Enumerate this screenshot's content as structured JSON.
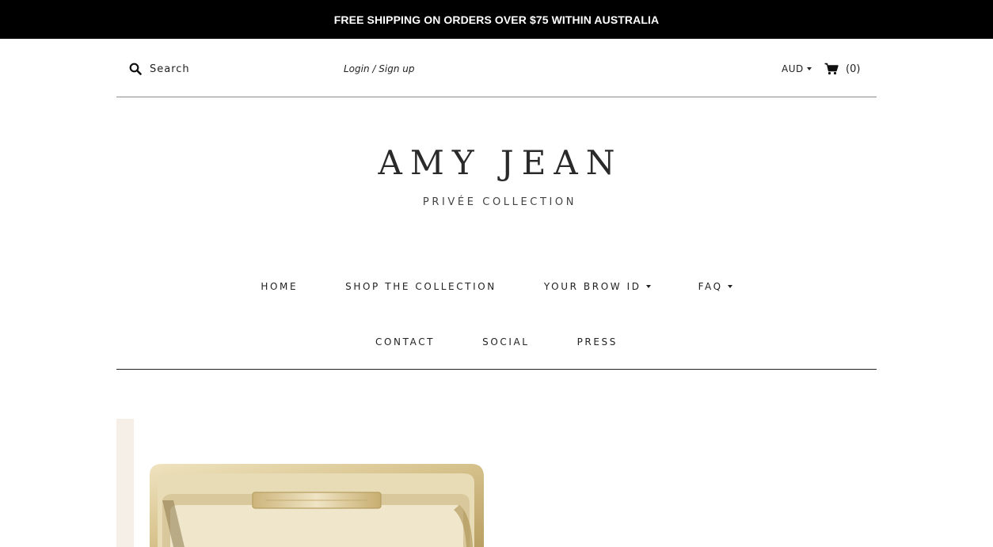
{
  "announcement": {
    "text": "FREE SHIPPING ON ORDERS OVER $75 WITHIN AUSTRALIA"
  },
  "utility": {
    "search_placeholder": "Search",
    "search_icon": "search-icon",
    "login_label": "Login / Sign up",
    "currency_label": "AUD",
    "cart_icon": "cart-icon",
    "cart_count": "(0)"
  },
  "brand": {
    "name": "AMY JEAN",
    "tagline": "PRIVÉE COLLECTION"
  },
  "nav": {
    "row1": [
      "HOME",
      "SHOP THE COLLECTION",
      "YOUR BROW ID",
      "FAQ"
    ],
    "row2": [
      "CONTACT",
      "SOCIAL",
      "PRESS"
    ]
  },
  "colors": {
    "announcement_bg": "#000000",
    "text": "#222222",
    "hero_strip": "#f6efe7",
    "gold": "#d4c08f"
  }
}
